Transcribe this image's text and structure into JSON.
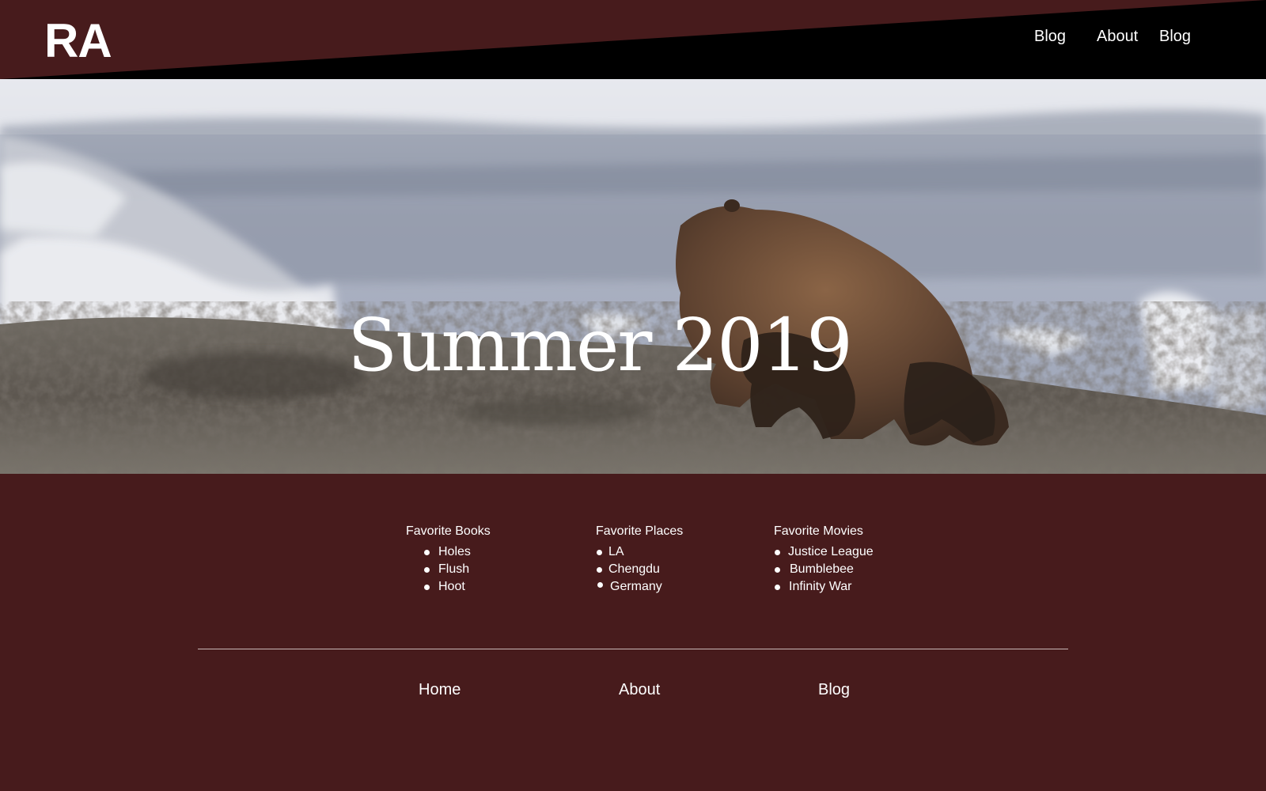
{
  "header": {
    "logo": "RA",
    "nav": [
      {
        "label": "Blog"
      },
      {
        "label": "About"
      },
      {
        "label": "Blog"
      }
    ]
  },
  "hero": {
    "title": "Summer 2019",
    "image_icon": "grizzly-bear-photo"
  },
  "favorites": [
    {
      "title": "Favorite Books",
      "items": [
        "Holes",
        "Flush",
        "Hoot"
      ]
    },
    {
      "title": "Favorite Places",
      "items": [
        "LA",
        "Chengdu",
        "Germany"
      ]
    },
    {
      "title": "Favorite Movies",
      "items": [
        "Justice League",
        "Bumblebee",
        "Infinity War"
      ]
    }
  ],
  "footer": {
    "nav": [
      {
        "label": "Home"
      },
      {
        "label": "About"
      },
      {
        "label": "Blog"
      }
    ]
  },
  "colors": {
    "background": "#471b1c",
    "header_band": "#000000",
    "text": "#ffffff"
  }
}
